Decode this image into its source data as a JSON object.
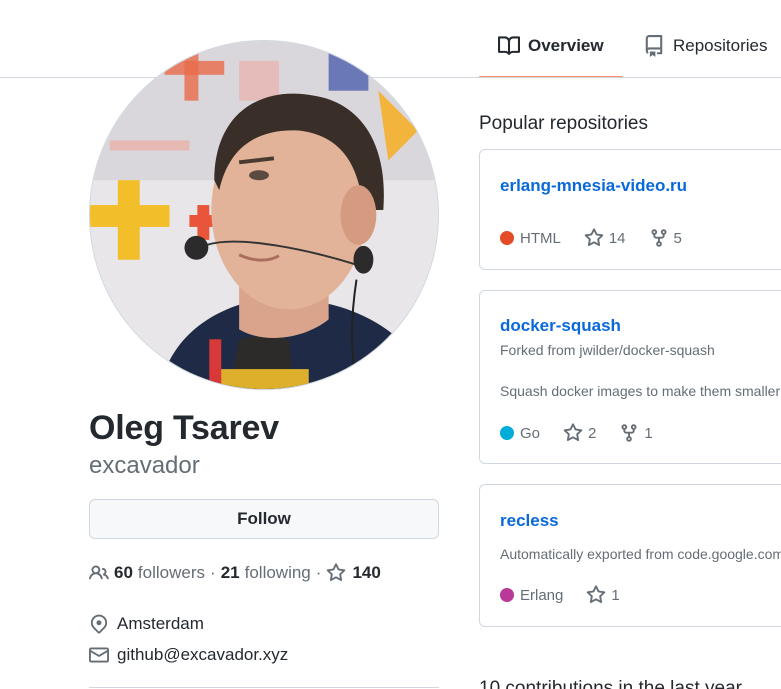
{
  "tabs": [
    {
      "label": "Overview",
      "icon": "book-icon",
      "selected": true
    },
    {
      "label": "Repositories",
      "icon": "repo-icon",
      "selected": false
    }
  ],
  "profile": {
    "fullname": "Oleg Tsarev",
    "username": "excavador",
    "follow_label": "Follow",
    "followers_count": "60",
    "followers_label": "followers",
    "separator": "·",
    "following_count": "21",
    "following_label": "following",
    "stars_count": "140",
    "location": "Amsterdam",
    "email": "github@excavador.xyz"
  },
  "popular": {
    "title": "Popular repositories",
    "repos": [
      {
        "name": "erlang-mnesia-video.ru",
        "fork_note": "",
        "description": "",
        "language": "HTML",
        "language_color": "#e34c26",
        "stars": "14",
        "forks": "5"
      },
      {
        "name": "docker-squash",
        "fork_note": "Forked from jwilder/docker-squash",
        "description": "Squash docker images to make them smaller",
        "language": "Go",
        "language_color": "#00ADD8",
        "stars": "2",
        "forks": "1"
      },
      {
        "name": "recless",
        "fork_note": "",
        "description": "Automatically exported from code.google.com/p/recless",
        "language": "Erlang",
        "language_color": "#B83998",
        "stars": "1",
        "forks": ""
      }
    ]
  },
  "contributions_title": "10 contributions in the last year",
  "colors": {
    "link": "#0969da",
    "muted": "#656d76",
    "tab_underline": "#fd8c73",
    "border": "#d0d7de"
  }
}
